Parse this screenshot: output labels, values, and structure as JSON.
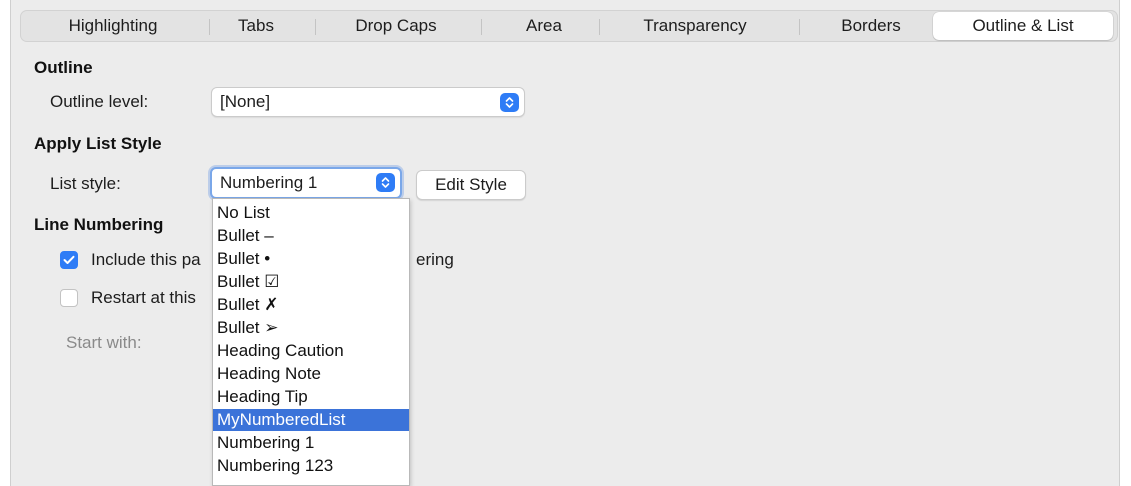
{
  "tabs": [
    {
      "label": "Highlighting"
    },
    {
      "label": "Tabs"
    },
    {
      "label": "Drop Caps"
    },
    {
      "label": "Area"
    },
    {
      "label": "Transparency"
    },
    {
      "label": "Borders"
    },
    {
      "label": "Outline & List",
      "active": true
    }
  ],
  "outline": {
    "heading": "Outline",
    "level_label": "Outline level:",
    "level_value": "[None]"
  },
  "list_style": {
    "heading": "Apply List Style",
    "label": "List style:",
    "value": "Numbering 1",
    "edit_button": "Edit Style"
  },
  "line_numbering": {
    "heading": "Line Numbering",
    "include_label_left": "Include this pa",
    "include_label_right": "ering",
    "include_checked": true,
    "restart_label": "Restart at this",
    "restart_checked": false,
    "start_with_label": "Start with:"
  },
  "dropdown": {
    "options": [
      "No List",
      "Bullet –",
      "Bullet •",
      "Bullet ☑",
      "Bullet ✗",
      "Bullet ➢",
      "Heading Caution",
      "Heading Note",
      "Heading Tip",
      "MyNumberedList",
      "Numbering 1",
      "Numbering 123"
    ],
    "highlighted": "MyNumberedList"
  },
  "colors": {
    "accent": "#2e7cf6",
    "highlight": "#3b73d9",
    "panel": "#ececec"
  }
}
